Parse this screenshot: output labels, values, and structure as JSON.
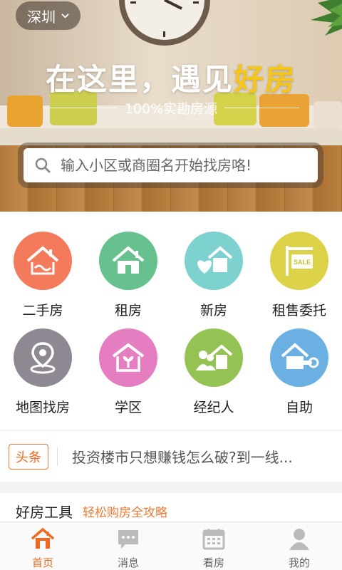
{
  "city": {
    "name": "深圳"
  },
  "banner": {
    "title_part1": "在这里，遇见",
    "title_highlight": "好房",
    "subtitle": "100%实勘房源"
  },
  "search": {
    "placeholder": "输入小区或商圈名开始找房咯!"
  },
  "grid": [
    {
      "label": "二手房",
      "color": "#f47a5c",
      "icon": "handshake-house-icon"
    },
    {
      "label": "租房",
      "color": "#67c18f",
      "icon": "house-icon"
    },
    {
      "label": "新房",
      "color": "#7dd1cf",
      "icon": "heart-house-icon"
    },
    {
      "label": "租售委托",
      "color": "#dbd247",
      "icon": "sale-sign-icon"
    },
    {
      "label": "地图找房",
      "color": "#8e8893",
      "icon": "map-pin-icon"
    },
    {
      "label": "学区",
      "color": "#e47ec0",
      "icon": "school-house-icon"
    },
    {
      "label": "经纪人",
      "color": "#94c353",
      "icon": "agent-people-icon"
    },
    {
      "label": "自助",
      "color": "#6ab0e3",
      "icon": "key-house-icon"
    }
  ],
  "news": {
    "badge": "头条",
    "headline": "投资楼市只想赚钱怎么破?到一线..."
  },
  "tools": {
    "title": "好房工具",
    "subtitle": "轻松购房全攻略"
  },
  "tabs": [
    {
      "label": "首页",
      "icon": "home-icon",
      "active": true
    },
    {
      "label": "消息",
      "icon": "message-icon",
      "active": false
    },
    {
      "label": "看房",
      "icon": "calendar-icon",
      "active": false
    },
    {
      "label": "我的",
      "icon": "profile-icon",
      "active": false
    }
  ],
  "colors": {
    "accent": "#f06a1f",
    "highlight": "#f5c518"
  }
}
